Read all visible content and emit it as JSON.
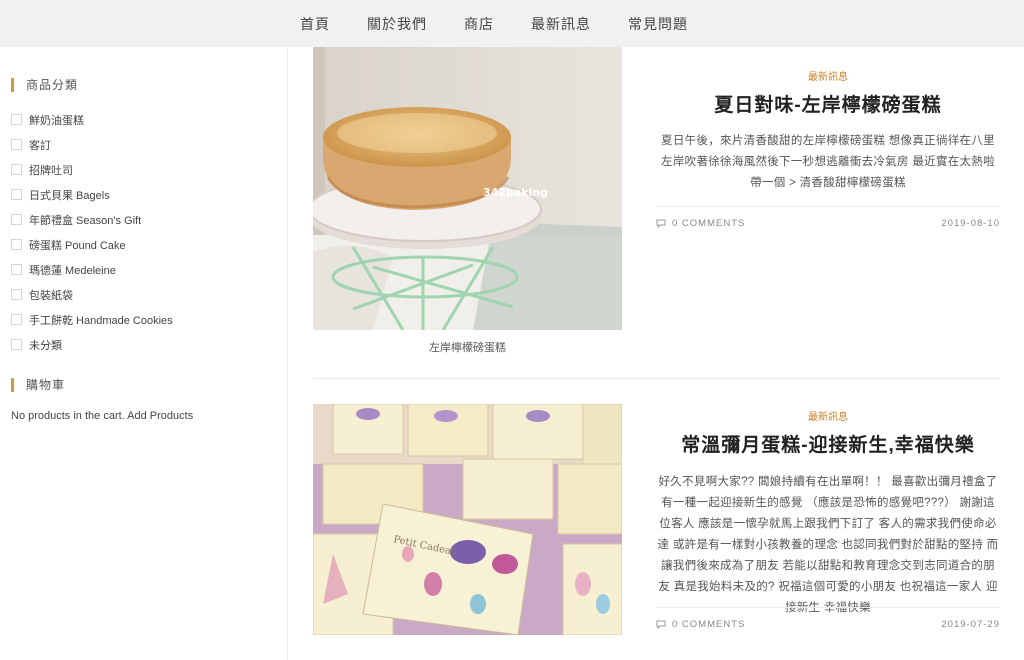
{
  "nav": {
    "items": [
      "首頁",
      "關於我們",
      "商店",
      "最新訊息",
      "常見問題"
    ]
  },
  "sidebar": {
    "categories_title": "商品分類",
    "categories": [
      "鮮奶油蛋糕",
      "客訂",
      "招牌吐司",
      "日式貝果 Bagels",
      "年節禮盒 Season's Gift",
      "磅蛋糕 Pound Cake",
      "瑪德蓮 Medeleine",
      "包裝紙袋",
      "手工餅乾 Handmade Cookies",
      "未分類"
    ],
    "cart_title": "購物車",
    "cart_text": "No products in the cart. Add Products"
  },
  "posts": [
    {
      "category": "最新訊息",
      "title": "夏日對味-左岸檸檬磅蛋糕",
      "excerpt": "夏日午後，來片清香酸甜的左岸檸檬磅蛋糕 想像真正徜徉在八里左岸吹著徐徐海風然後下一秒想逃離衝去冷氣房 最近實在太熱啦 帶一個 > 清香酸甜檸檬磅蛋糕",
      "comments": "0 COMMENTS",
      "date": "2019-08-10",
      "image_caption": "左岸檸檬磅蛋糕",
      "watermark": "342baking"
    },
    {
      "category": "最新訊息",
      "title": "常溫彌月蛋糕-迎接新生,幸福快樂",
      "excerpt": "好久不見啊大家?? 闆娘持續有在出單啊！！ 最喜歡出彌月禮盒了 有一種一起迎接新生的感覺 （應該是恐怖的感覺吧???） 謝謝這位客人 應該是一懷孕就馬上跟我們下訂了 客人的需求我們使命必達 或許是有一樣對小孩教養的理念 也認同我們對於甜點的堅持 而讓我們後來成為了朋友 若能以甜點和教育理念交到志同道合的朋友 真是我始料未及的? 祝福這個可愛的小朋友 也祝福這一家人 迎接新生 幸福快樂",
      "comments": "0 COMMENTS",
      "date": "2019-07-29",
      "box_text": "Petit Cadeau"
    }
  ],
  "colors": {
    "accent": "#d19a3d",
    "category": "#c9822b",
    "nav_bg": "#f1f1f1"
  },
  "icons": {
    "comment": "speech-bubble-icon"
  }
}
